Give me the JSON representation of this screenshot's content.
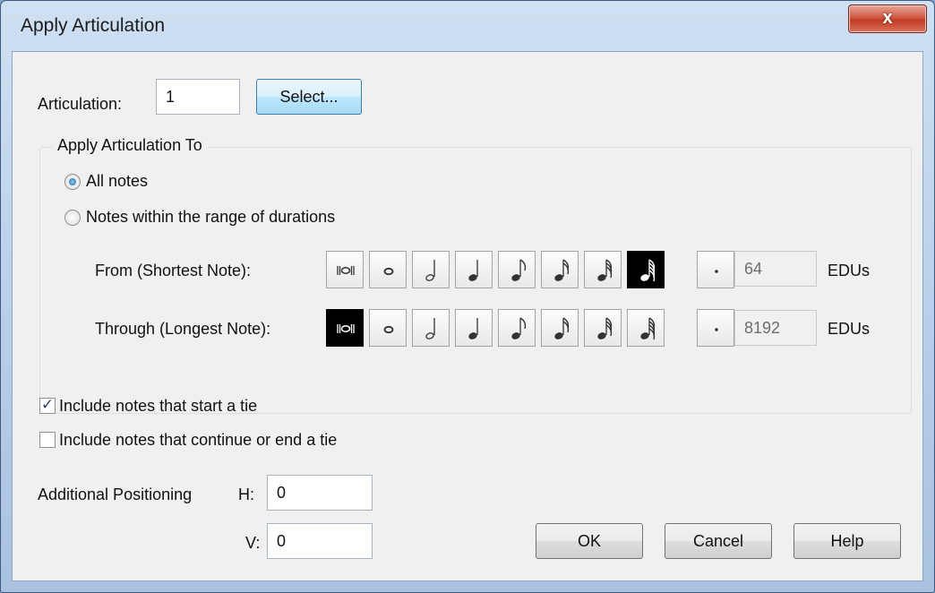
{
  "window": {
    "title": "Apply Articulation",
    "close_glyph": "x"
  },
  "articulation": {
    "label": "Articulation:",
    "value": "1",
    "select_label": "Select..."
  },
  "group": {
    "title": "Apply Articulation To",
    "option_all": "All notes",
    "option_range": "Notes within the range of durations",
    "selected_option": "All notes",
    "from_label": "From (Shortest Note):",
    "through_label": "Through (Longest Note):",
    "durations": [
      "double-whole-note-icon",
      "whole-note-icon",
      "half-note-icon",
      "quarter-note-icon",
      "eighth-note-icon",
      "sixteenth-note-icon",
      "thirty-second-note-icon",
      "sixty-fourth-note-icon"
    ],
    "dot_icon": "dot-icon",
    "from_selected": "sixty-fourth-note-icon",
    "through_selected": "double-whole-note-icon",
    "from_edus": "64",
    "through_edus": "8192",
    "edus_unit": "EDUs"
  },
  "ties": {
    "start_label": "Include notes that start a tie",
    "start_checked": true,
    "continue_label": "Include notes that continue or end a tie",
    "continue_checked": false
  },
  "positioning": {
    "label": "Additional Positioning",
    "h_label": "H:",
    "h_value": "0",
    "v_label": "V:",
    "v_value": "0"
  },
  "buttons": {
    "ok": "OK",
    "cancel": "Cancel",
    "help": "Help"
  },
  "colors": {
    "selected_duration": "#000000",
    "title_bar": "#b6cde8",
    "close_button": "#c33a22"
  }
}
